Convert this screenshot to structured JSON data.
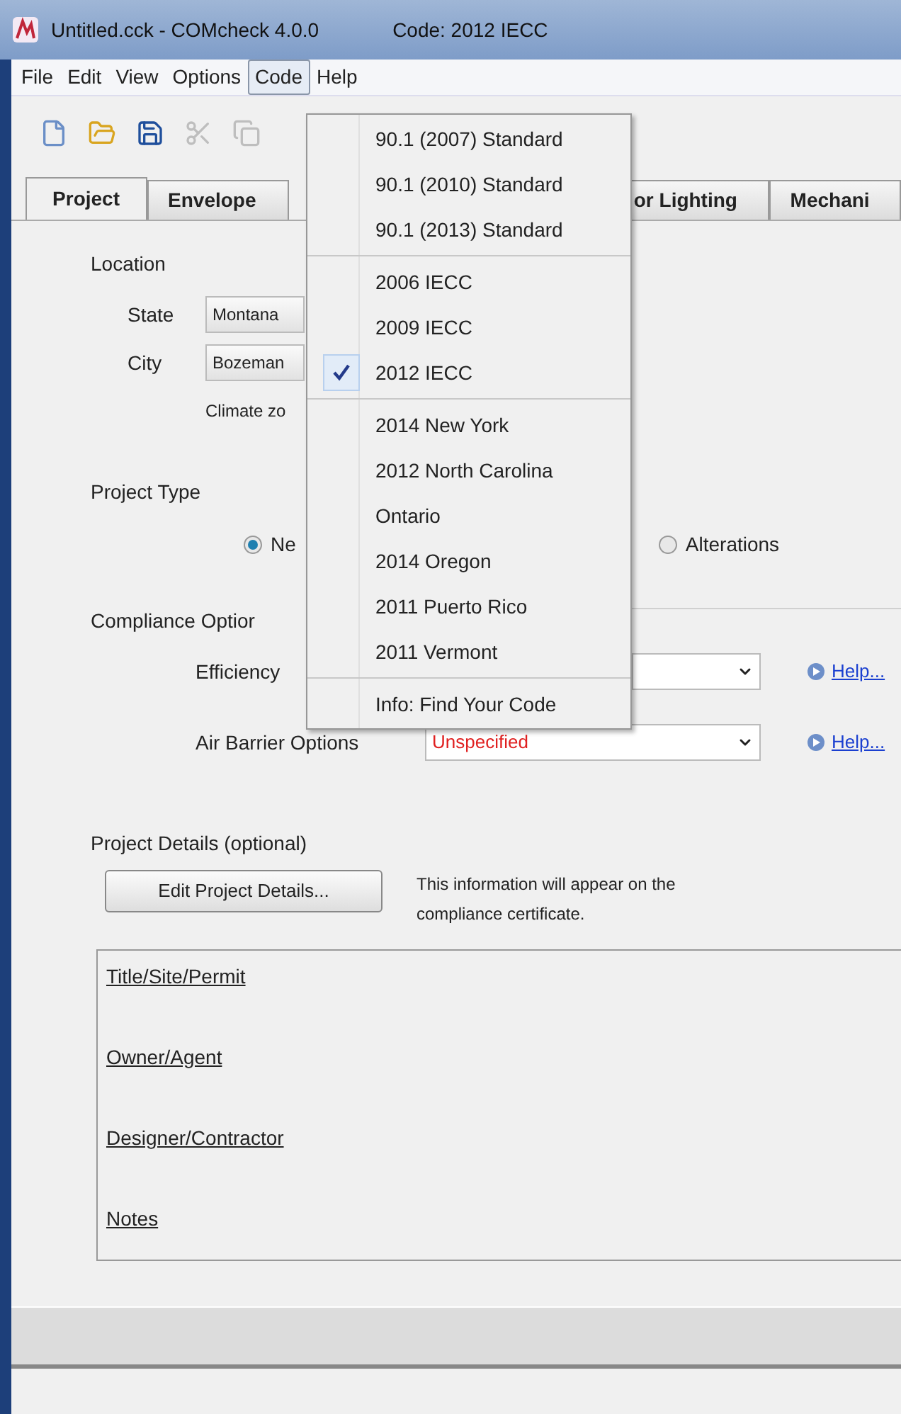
{
  "window": {
    "title": "Untitled.cck - COMcheck 4.0.0",
    "code": "Code: 2012 IECC"
  },
  "menu_bar": [
    {
      "label": "File",
      "selected": false
    },
    {
      "label": "Edit",
      "selected": false
    },
    {
      "label": "View",
      "selected": false
    },
    {
      "label": "Options",
      "selected": false
    },
    {
      "label": "Code",
      "selected": true
    },
    {
      "label": "Help",
      "selected": false
    }
  ],
  "toolbar": [
    {
      "kind": "new",
      "disabled": false
    },
    {
      "kind": "open",
      "disabled": false
    },
    {
      "kind": "save",
      "disabled": false
    },
    {
      "kind": "cut",
      "disabled": true
    },
    {
      "kind": "copy",
      "disabled": true
    }
  ],
  "tabs": [
    {
      "label": "Project",
      "selected": true
    },
    {
      "label": "Envelope",
      "selected": false
    },
    {
      "label": "or Lighting",
      "selected": false
    },
    {
      "label": "Mechani",
      "selected": false
    }
  ],
  "code_menu": {
    "groups": [
      {
        "items": [
          {
            "label": "90.1 (2007) Standard",
            "checked": false
          },
          {
            "label": "90.1 (2010) Standard",
            "checked": false
          },
          {
            "label": "90.1 (2013) Standard",
            "checked": false
          }
        ]
      },
      {
        "items": [
          {
            "label": "2006 IECC",
            "checked": false
          },
          {
            "label": "2009 IECC",
            "checked": false
          },
          {
            "label": "2012 IECC",
            "checked": true
          }
        ]
      },
      {
        "items": [
          {
            "label": "2014 New York",
            "checked": false
          },
          {
            "label": "2012 North Carolina",
            "checked": false
          },
          {
            "label": "Ontario",
            "checked": false
          },
          {
            "label": "2014 Oregon",
            "checked": false
          },
          {
            "label": "2011 Puerto Rico",
            "checked": false
          },
          {
            "label": "2011 Vermont",
            "checked": false
          }
        ]
      },
      {
        "items": [
          {
            "label": "Info: Find Your Code",
            "checked": false
          }
        ]
      }
    ]
  },
  "location": {
    "title": "Location",
    "state_label": "State",
    "state": "Montana",
    "city_label": "City",
    "city": "Bozeman",
    "climate": "Climate zo"
  },
  "project_type": {
    "title": "Project Type",
    "options": [
      {
        "label": "Ne",
        "selected": true
      },
      {
        "label": "Alterations",
        "selected": false
      }
    ]
  },
  "compliance": {
    "title": "Compliance Optior",
    "rows": [
      {
        "label": "Efficiency",
        "help": "Help..."
      },
      {
        "label": "Air Barrier Options",
        "value": "Unspecified",
        "help": "Help..."
      }
    ]
  },
  "project_details": {
    "title": "Project Details (optional)",
    "button": "Edit Project Details...",
    "note": "This information will appear on the compliance certificate.",
    "links": [
      "Title/Site/Permit",
      "Owner/Agent",
      "Designer/Contractor",
      "Notes"
    ]
  }
}
